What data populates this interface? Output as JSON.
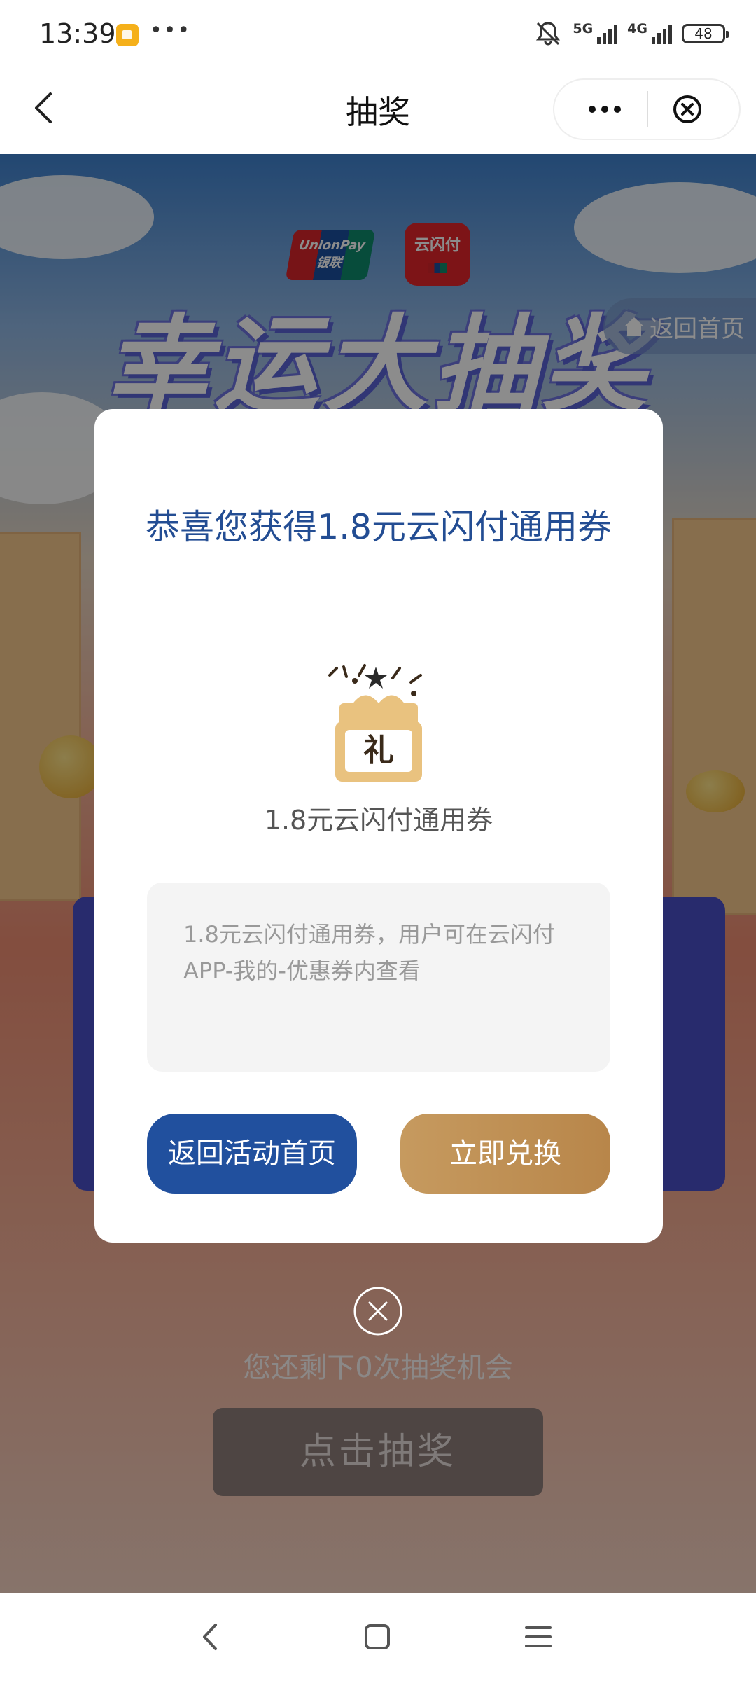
{
  "status": {
    "time": "13:39",
    "net_5g": "5G",
    "net_4g": "4G",
    "battery": "48"
  },
  "nav": {
    "title": "抽奖"
  },
  "background": {
    "logo_unionpay": "UnionPay 银联",
    "logo_ysf": "云闪付",
    "hero_title": "幸运大抽奖",
    "home_label": "返回首页",
    "remaining": "您还剩下0次抽奖机会",
    "draw_button": "点击抽奖"
  },
  "modal": {
    "title": "恭喜您获得1.8元云闪付通用券",
    "gift_char": "礼",
    "prize_name": "1.8元云闪付通用券",
    "description": "1.8元云闪付通用券，用户可在云闪付APP-我的-优惠券内查看",
    "back_button": "返回活动首页",
    "redeem_button": "立即兑换"
  },
  "colors": {
    "primary_blue": "#21509e",
    "gold": "#b8864a",
    "title_blue": "#234d93"
  }
}
